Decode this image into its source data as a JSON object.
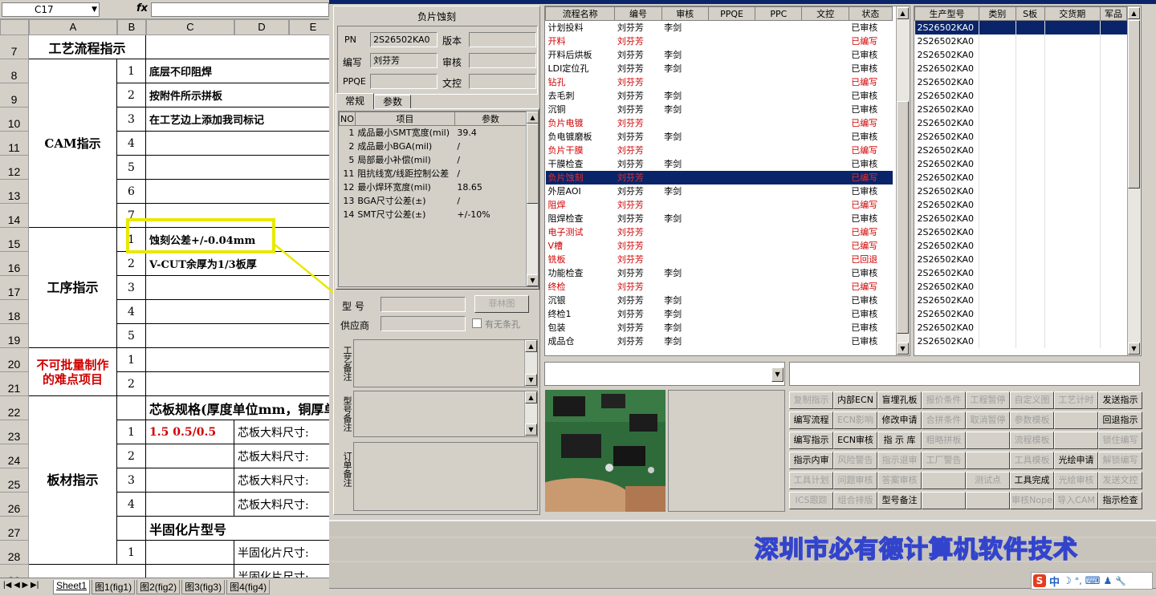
{
  "excel": {
    "name_box": "C17",
    "fx_label": "fx",
    "columns": [
      "A",
      "B",
      "C",
      "D",
      "E"
    ],
    "rows": [
      {
        "num": "7",
        "a": "工艺流程指示"
      },
      {
        "num": "8",
        "b": "1",
        "c": "底层不印阻焊"
      },
      {
        "num": "9",
        "b": "2",
        "c": "按附件所示拼板"
      },
      {
        "num": "10",
        "b": "3",
        "c": "在工艺边上添加我司标记"
      },
      {
        "num": "11",
        "b": "4",
        "c": ""
      },
      {
        "num": "12",
        "b": "5",
        "c": ""
      },
      {
        "num": "13",
        "b": "6",
        "c": ""
      },
      {
        "num": "14",
        "b": "7",
        "c": ""
      },
      {
        "num": "15",
        "b": "1",
        "c": "蚀刻公差+/-0.04mm"
      },
      {
        "num": "16",
        "b": "2",
        "c": "V-CUT余厚为1/3板厚"
      },
      {
        "num": "17",
        "b": "3",
        "c": ""
      },
      {
        "num": "18",
        "b": "4",
        "c": ""
      },
      {
        "num": "19",
        "b": "5",
        "c": ""
      },
      {
        "num": "20",
        "b": "1",
        "c": ""
      },
      {
        "num": "21",
        "b": "2",
        "c": ""
      },
      {
        "num": "22",
        "b": "",
        "c": "芯板规格(厚度单位mm，铜厚单"
      },
      {
        "num": "23",
        "b": "1",
        "c": "1.5 0.5/0.5",
        "d": "芯板大料尺寸:"
      },
      {
        "num": "24",
        "b": "2",
        "c": "",
        "d": "芯板大料尺寸:"
      },
      {
        "num": "25",
        "b": "3",
        "c": "",
        "d": "芯板大料尺寸:"
      },
      {
        "num": "26",
        "b": "4",
        "c": "",
        "d": "芯板大料尺寸:"
      },
      {
        "num": "27",
        "b": "",
        "c": "半固化片型号"
      },
      {
        "num": "28",
        "b": "1",
        "c": "",
        "d": "半固化片尺寸:"
      },
      {
        "num": "29",
        "b": "",
        "c": "",
        "d": "半固化片尺寸:"
      }
    ],
    "merged_labels": {
      "cam": "CAM指示",
      "process": "工序指示",
      "hard": "不可批量制作的难点项目",
      "board": "板材指示"
    },
    "sheet_tabs": [
      "Sheet1",
      "图1(fig1)",
      "图2(fig2)",
      "图3(fig3)",
      "图4(fig4)"
    ]
  },
  "app": {
    "group_title": "负片蚀刻",
    "pn_label": "PN",
    "pn_value": "2S26502KA0",
    "version_label": "版本",
    "author_label": "编写",
    "author_value": "刘芬芳",
    "review_label": "审核",
    "ppqe_label": "PPQE",
    "doccontrol_label": "文控",
    "tabs": [
      "常规",
      "参数"
    ],
    "param_headers": [
      "NO",
      "项目",
      "参数"
    ],
    "params": [
      {
        "no": "1",
        "item": "成品最小SMT宽度(mil)",
        "val": "39.4"
      },
      {
        "no": "2",
        "item": "成品最小BGA(mil)",
        "val": "/"
      },
      {
        "no": "5",
        "item": "局部最小补偿(mil)",
        "val": "/"
      },
      {
        "no": "11",
        "item": "阻抗线宽/线距控制公差",
        "val": "/"
      },
      {
        "no": "12",
        "item": "最小焊环宽度(mil)",
        "val": "18.65"
      },
      {
        "no": "13",
        "item": "BGA尺寸公差(±)",
        "val": "/"
      },
      {
        "no": "14",
        "item": "SMT尺寸公差(±)",
        "val": "+/-10%"
      }
    ],
    "model_label": "型 号",
    "philin_button": "菲林图",
    "supplier_label": "供应商",
    "no_check_label": "有无条孔",
    "note_labels": [
      "工艺备注",
      "型号备注",
      "订单备注"
    ],
    "flow_headers": [
      "流程名称",
      "编号",
      "审核",
      "PPQE",
      "PPC",
      "文控",
      "状态"
    ],
    "flow": [
      {
        "name": "计划投料",
        "id": "刘芬芳",
        "rev": "李剑",
        "st": "已审核",
        "red": false
      },
      {
        "name": "开料",
        "id": "刘芬芳",
        "rev": "",
        "st": "已编写",
        "red": true
      },
      {
        "name": "开料后烘板",
        "id": "刘芬芳",
        "rev": "李剑",
        "st": "已审核",
        "red": false
      },
      {
        "name": "LDI定位孔",
        "id": "刘芬芳",
        "rev": "李剑",
        "st": "已审核",
        "red": false
      },
      {
        "name": "钻孔",
        "id": "刘芬芳",
        "rev": "",
        "st": "已编写",
        "red": true
      },
      {
        "name": "去毛刺",
        "id": "刘芬芳",
        "rev": "李剑",
        "st": "已审核",
        "red": false
      },
      {
        "name": "沉铜",
        "id": "刘芬芳",
        "rev": "李剑",
        "st": "已审核",
        "red": false
      },
      {
        "name": "负片电镀",
        "id": "刘芬芳",
        "rev": "",
        "st": "已编写",
        "red": true
      },
      {
        "name": "负电镀磨板",
        "id": "刘芬芳",
        "rev": "李剑",
        "st": "已审核",
        "red": false
      },
      {
        "name": "负片干膜",
        "id": "刘芬芳",
        "rev": "",
        "st": "已编写",
        "red": true
      },
      {
        "name": "干膜检查",
        "id": "刘芬芳",
        "rev": "李剑",
        "st": "已审核",
        "red": false
      },
      {
        "name": "负片蚀刻",
        "id": "刘芬芳",
        "rev": "",
        "st": "已编写",
        "red": true,
        "sel": true
      },
      {
        "name": "外层AOI",
        "id": "刘芬芳",
        "rev": "李剑",
        "st": "已审核",
        "red": false
      },
      {
        "name": "阻焊",
        "id": "刘芬芳",
        "rev": "",
        "st": "已编写",
        "red": true
      },
      {
        "name": "阻焊检查",
        "id": "刘芬芳",
        "rev": "李剑",
        "st": "已审核",
        "red": false
      },
      {
        "name": "电子测试",
        "id": "刘芬芳",
        "rev": "",
        "st": "已编写",
        "red": true
      },
      {
        "name": "V槽",
        "id": "刘芬芳",
        "rev": "",
        "st": "已编写",
        "red": true
      },
      {
        "name": "铣板",
        "id": "刘芬芳",
        "rev": "",
        "st": "已回退",
        "red": true
      },
      {
        "name": "功能检查",
        "id": "刘芬芳",
        "rev": "李剑",
        "st": "已审核",
        "red": false
      },
      {
        "name": "终检",
        "id": "刘芬芳",
        "rev": "",
        "st": "已编写",
        "red": true
      },
      {
        "name": "沉银",
        "id": "刘芬芳",
        "rev": "李剑",
        "st": "已审核",
        "red": false
      },
      {
        "name": "终检1",
        "id": "刘芬芳",
        "rev": "李剑",
        "st": "已审核",
        "red": false
      },
      {
        "name": "包装",
        "id": "刘芬芳",
        "rev": "李剑",
        "st": "已审核",
        "red": false
      },
      {
        "name": "成品仓",
        "id": "刘芬芳",
        "rev": "李剑",
        "st": "已审核",
        "red": false
      }
    ],
    "model_headers": [
      "生产型号",
      "类别",
      "S板",
      "交货期",
      "军品"
    ],
    "model_value": "2S26502KA0",
    "model_count": 24,
    "buttons": [
      [
        {
          "t": "复制指示",
          "d": true
        },
        {
          "t": "内部ECN",
          "d": false
        },
        {
          "t": "盲埋孔板",
          "d": false
        },
        {
          "t": "报价条件",
          "d": true
        },
        {
          "t": "工程暂停",
          "d": true
        },
        {
          "t": "自定义图",
          "d": true
        },
        {
          "t": "工艺计时",
          "d": true
        },
        {
          "t": "发送指示",
          "d": false
        }
      ],
      [
        {
          "t": "编写流程",
          "d": false
        },
        {
          "t": "ECN影响",
          "d": true
        },
        {
          "t": "修改申请",
          "d": false
        },
        {
          "t": "合拼条件",
          "d": true
        },
        {
          "t": "取消暂停",
          "d": true
        },
        {
          "t": "参数模板",
          "d": true
        },
        {
          "t": "",
          "d": true
        },
        {
          "t": "回退指示",
          "d": false
        }
      ],
      [
        {
          "t": "编写指示",
          "d": false
        },
        {
          "t": "ECN审核",
          "d": false
        },
        {
          "t": "指 示 库",
          "d": false
        },
        {
          "t": "粗略拼板",
          "d": true
        },
        {
          "t": "",
          "d": true
        },
        {
          "t": "流程模板",
          "d": true
        },
        {
          "t": "",
          "d": true
        },
        {
          "t": "锁住编写",
          "d": true
        }
      ],
      [
        {
          "t": "指示内审",
          "d": false
        },
        {
          "t": "风险警告",
          "d": true
        },
        {
          "t": "指示退审",
          "d": true
        },
        {
          "t": "工厂警告",
          "d": true
        },
        {
          "t": "",
          "d": true
        },
        {
          "t": "工具模板",
          "d": true
        },
        {
          "t": "光绘申请",
          "d": false
        },
        {
          "t": "解锁编写",
          "d": true
        }
      ],
      [
        {
          "t": "工具计划",
          "d": true
        },
        {
          "t": "问题审核",
          "d": true
        },
        {
          "t": "答案审核",
          "d": true
        },
        {
          "t": "",
          "d": true
        },
        {
          "t": "测试点",
          "d": true
        },
        {
          "t": "工具完成",
          "d": false
        },
        {
          "t": "光绘审核",
          "d": true
        },
        {
          "t": "发送文控",
          "d": true
        }
      ],
      [
        {
          "t": "ICS跟踪",
          "d": true
        },
        {
          "t": "组合排版",
          "d": true
        },
        {
          "t": "型号备注",
          "d": false
        },
        {
          "t": "",
          "d": true
        },
        {
          "t": "",
          "d": true
        },
        {
          "t": "审核Nope",
          "d": true
        },
        {
          "t": "导入CAM",
          "d": true
        },
        {
          "t": "指示检查",
          "d": false
        }
      ]
    ],
    "watermark": "深圳市必有德计算机软件技术",
    "ime_bar": [
      "S",
      "中",
      "☽",
      "°,",
      "⌨",
      "♟",
      "🔧"
    ]
  },
  "colors": {
    "accent": "#0a246a",
    "red": "#d00000",
    "watermark": "#3344cc",
    "highlight": "#e8e800"
  }
}
